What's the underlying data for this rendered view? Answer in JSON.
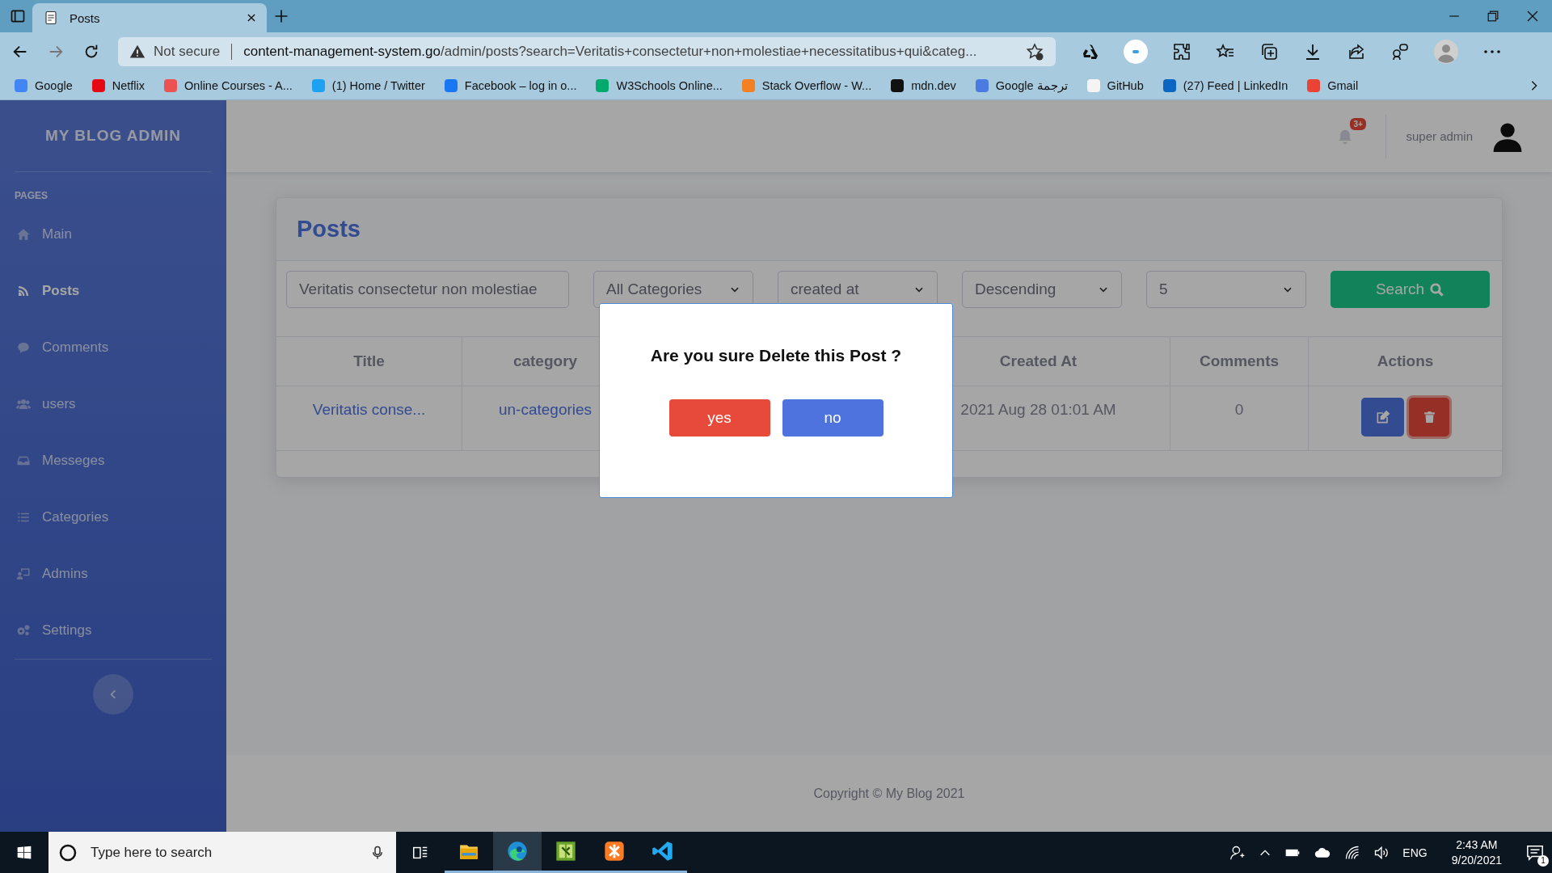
{
  "browser": {
    "tabs": [
      {
        "title": "Posts",
        "selected": true
      }
    ],
    "address": {
      "warning": "Not secure",
      "host": "content-management-system.go",
      "path": "/admin/posts?search=Veritatis+consectetur+non+molestiae+necessitatibus+qui&categ..."
    },
    "bookmarks": [
      {
        "label": "Google",
        "color": "#4285f4"
      },
      {
        "label": "Netflix",
        "color": "#e50914"
      },
      {
        "label": "Online Courses - A...",
        "color": "#ec5252"
      },
      {
        "label": "(1) Home / Twitter",
        "color": "#1da1f2"
      },
      {
        "label": "Facebook – log in o...",
        "color": "#1877f2"
      },
      {
        "label": "W3Schools Online...",
        "color": "#04aa6d"
      },
      {
        "label": "Stack Overflow - W...",
        "color": "#f48024"
      },
      {
        "label": "mdn.dev",
        "color": "#111111"
      },
      {
        "label": "Google ترجمة",
        "color": "#4a7be0"
      },
      {
        "label": "GitHub",
        "color": "#f4f4f4"
      },
      {
        "label": "(27) Feed | LinkedIn",
        "color": "#0a66c2"
      },
      {
        "label": "Gmail",
        "color": "#ea4335"
      }
    ]
  },
  "sidebar": {
    "brand": "MY BLOG ADMIN",
    "heading": "PAGES",
    "items": [
      {
        "label": "Main",
        "kind": "home",
        "selected": false
      },
      {
        "label": "Posts",
        "kind": "blog",
        "selected": true
      },
      {
        "label": "Comments",
        "kind": "comment",
        "selected": false
      },
      {
        "label": "users",
        "kind": "users",
        "selected": false
      },
      {
        "label": "Messeges",
        "kind": "inbox",
        "selected": false
      },
      {
        "label": "Categories",
        "kind": "list",
        "selected": false
      },
      {
        "label": "Admins",
        "kind": "admin",
        "selected": false
      },
      {
        "label": "Settings",
        "kind": "gears",
        "selected": false
      }
    ]
  },
  "topbar": {
    "alerts_badge": "3+",
    "user": "super admin"
  },
  "posts": {
    "title": "Posts",
    "filters": {
      "search": "Veritatis consectetur non molestiae",
      "selects": [
        "All Categories",
        "created at",
        "Descending",
        "5"
      ],
      "button": "Search"
    },
    "table": {
      "columns": [
        "Title",
        "category",
        "Created At",
        "Comments",
        "Actions"
      ],
      "rows": [
        {
          "title": "Veritatis conse...",
          "category": "un-categories",
          "created_at": "2021 Aug 28 01:01 AM",
          "comments": "0"
        }
      ]
    }
  },
  "dialog": {
    "message": "Are you sure Delete this Post ?",
    "confirm": "yes",
    "cancel": "no"
  },
  "footer": "Copyright © My Blog 2021",
  "taskbar": {
    "search_placeholder": "Type here to search",
    "apps": [
      {
        "kind": "folder",
        "selected": false
      },
      {
        "kind": "edge",
        "selected": true
      },
      {
        "kind": "tool",
        "selected": false
      },
      {
        "kind": "xampp",
        "selected": false
      },
      {
        "kind": "vscode",
        "selected": false
      }
    ],
    "language": "ENG",
    "time": "2:43 AM",
    "date": "9/20/2021",
    "notifications": "1"
  }
}
